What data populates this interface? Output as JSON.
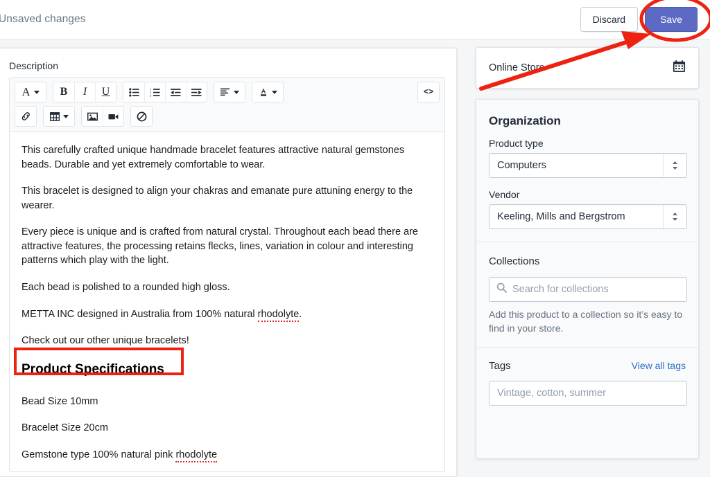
{
  "savebar": {
    "title": "Unsaved changes",
    "discard_label": "Discard",
    "save_label": "Save"
  },
  "main": {
    "description_label": "Description",
    "toolbar": {
      "row1": [
        {
          "name": "font-family-icon",
          "glyph": "A",
          "caret": true
        },
        {
          "name": "bold-icon",
          "glyph": "B",
          "caret": false
        },
        {
          "name": "italic-icon",
          "glyph": "I",
          "caret": false
        },
        {
          "name": "underline-icon",
          "glyph": "U",
          "caret": false
        },
        {
          "name": "bulleted-list-icon",
          "glyph": "",
          "caret": false
        },
        {
          "name": "numbered-list-icon",
          "glyph": "",
          "caret": false
        },
        {
          "name": "outdent-icon",
          "glyph": "",
          "caret": false
        },
        {
          "name": "indent-icon",
          "glyph": "",
          "caret": false
        },
        {
          "name": "align-icon",
          "glyph": "",
          "caret": true
        },
        {
          "name": "text-color-icon",
          "glyph": "A",
          "caret": true
        },
        {
          "name": "code-view-icon",
          "glyph": "<>",
          "caret": false
        }
      ],
      "row2": [
        {
          "name": "link-icon",
          "glyph": "",
          "caret": false
        },
        {
          "name": "table-icon",
          "glyph": "",
          "caret": true
        },
        {
          "name": "image-icon",
          "glyph": "",
          "caret": false
        },
        {
          "name": "video-icon",
          "glyph": "",
          "caret": false
        },
        {
          "name": "clear-formatting-icon",
          "glyph": "",
          "caret": false
        }
      ]
    },
    "body": {
      "paragraphs": [
        "This carefully crafted unique handmade bracelet features attractive natural gemstones beads.  Durable and yet extremely comfortable to wear.",
        "This bracelet is designed to align your chakras and emanate pure attuning energy to the wearer.",
        "Every piece is unique and is crafted from natural crystal.  Throughout each bead there are attractive features, the processing retains flecks, lines, variation in colour and interesting patterns which play with the light.",
        "Each bead is polished to a rounded high gloss."
      ],
      "metta_prefix": "METTA INC designed in Australia from 100% natural ",
      "metta_misspelled": "rhodolyte",
      "metta_suffix": ".",
      "check_out": "Check out our other unique bracelets!",
      "spec_heading": "Product Specifications",
      "specs": [
        "Bead Size 10mm",
        "Bracelet Size 20cm"
      ],
      "gemstone_prefix": "Gemstone type 100% natural pink ",
      "gemstone_misspelled": "rhodolyte"
    }
  },
  "sidebar": {
    "online_store": {
      "label": "Online Store",
      "icon": "calendar-icon"
    },
    "organization": {
      "title": "Organization",
      "product_type_label": "Product type",
      "product_type_value": "Computers",
      "vendor_label": "Vendor",
      "vendor_value": "Keeling, Mills and Bergstrom"
    },
    "collections": {
      "title": "Collections",
      "search_placeholder": "Search for collections",
      "helper": "Add this product to a collection so it’s easy to find in your store."
    },
    "tags": {
      "title": "Tags",
      "view_all_label": "View all tags",
      "input_placeholder": "Vintage, cotton, summer"
    }
  },
  "annotations": {
    "accent_color": "#ee2211",
    "save_highlight": "ellipse-around-save-button",
    "arrow": "arrow-pointing-to-save-button",
    "spec_highlight": "rectangle-around-product-specifications"
  },
  "colors": {
    "save_button": "#5c6ac4",
    "link": "#2a6ecc",
    "annotation_red": "#ee2211"
  }
}
